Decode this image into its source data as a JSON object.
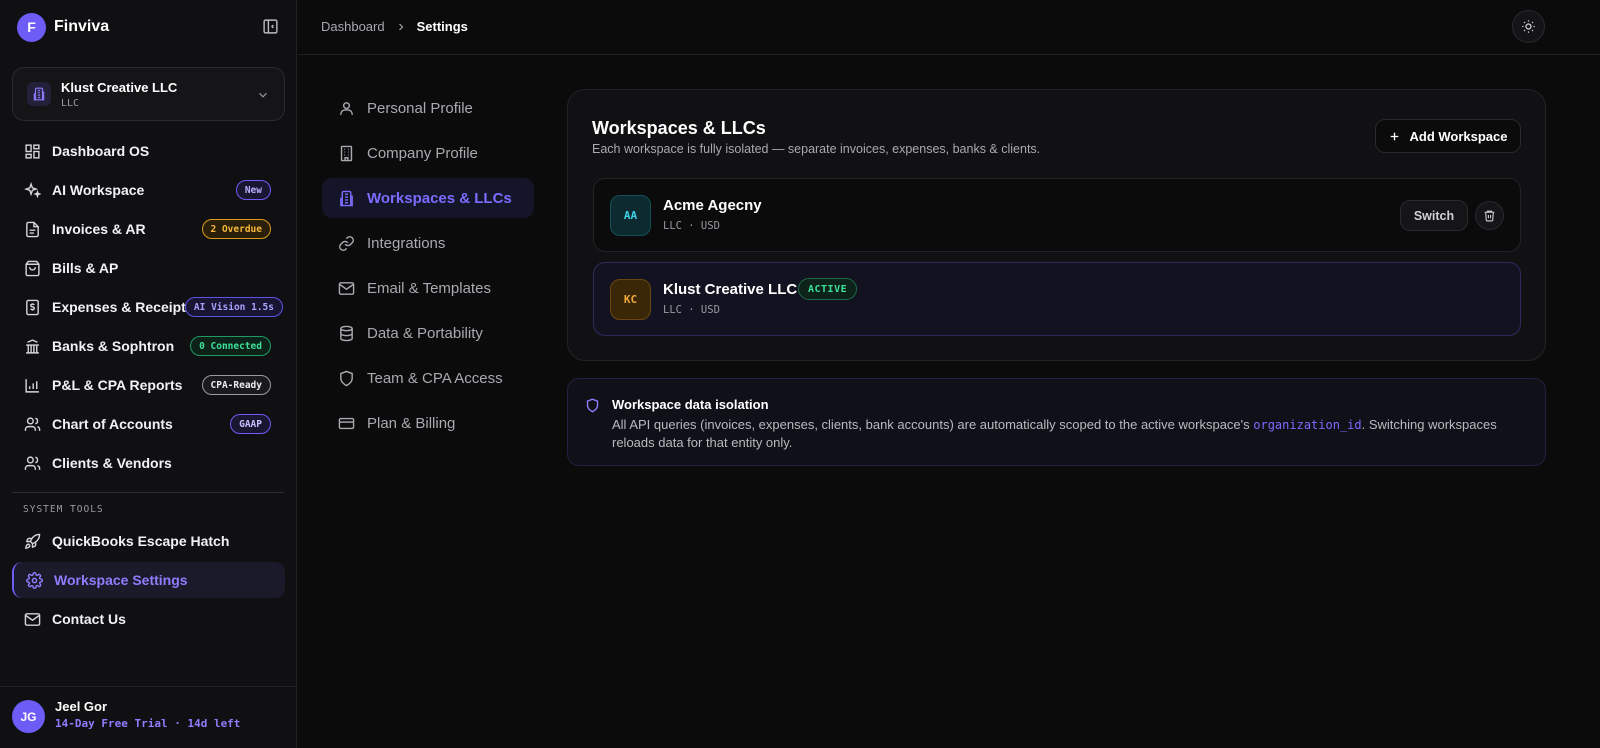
{
  "brand": {
    "logo_letter": "F",
    "name": "Finviva"
  },
  "org_switcher": {
    "name": "Klust Creative LLC",
    "type": "LLC"
  },
  "nav": {
    "items": [
      {
        "label": "Dashboard OS"
      },
      {
        "label": "AI Workspace",
        "badge": "New"
      },
      {
        "label": "Invoices & AR",
        "badge": "2 Overdue"
      },
      {
        "label": "Bills & AP"
      },
      {
        "label": "Expenses & Receipts",
        "badge": "AI Vision 1.5s"
      },
      {
        "label": "Banks & Sophtron",
        "badge": "0 Connected"
      },
      {
        "label": "P&L & CPA Reports",
        "badge": "CPA-Ready"
      },
      {
        "label": "Chart of Accounts",
        "badge": "GAAP"
      },
      {
        "label": "Clients & Vendors"
      }
    ],
    "section_label": "SYSTEM TOOLS",
    "system_items": [
      {
        "label": "QuickBooks Escape Hatch"
      },
      {
        "label": "Workspace Settings"
      },
      {
        "label": "Contact Us"
      }
    ]
  },
  "user": {
    "initials": "JG",
    "name": "Jeel Gor",
    "plan": "14-Day Free Trial · 14d left"
  },
  "breadcrumb": {
    "parent": "Dashboard",
    "current": "Settings"
  },
  "settings_nav": [
    {
      "label": "Personal Profile"
    },
    {
      "label": "Company Profile"
    },
    {
      "label": "Workspaces & LLCs"
    },
    {
      "label": "Integrations"
    },
    {
      "label": "Email & Templates"
    },
    {
      "label": "Data & Portability"
    },
    {
      "label": "Team & CPA Access"
    },
    {
      "label": "Plan & Billing"
    }
  ],
  "workspaces": {
    "title": "Workspaces & LLCs",
    "subtitle": "Each workspace is fully isolated — separate invoices, expenses, banks & clients.",
    "add_label": "Add Workspace",
    "rows": [
      {
        "initials": "AA",
        "name": "Acme Agecny",
        "meta": "LLC · USD",
        "switch_label": "Switch"
      },
      {
        "initials": "KC",
        "name": "Klust Creative LLC",
        "meta": "LLC · USD",
        "status": "ACTIVE"
      }
    ]
  },
  "info": {
    "title": "Workspace data isolation",
    "body_before": "All API queries (invoices, expenses, clients, bank accounts) are automatically scoped to the active workspace's ",
    "code": "organization_id",
    "body_after": ". Switching workspaces reloads data for that entity only."
  }
}
